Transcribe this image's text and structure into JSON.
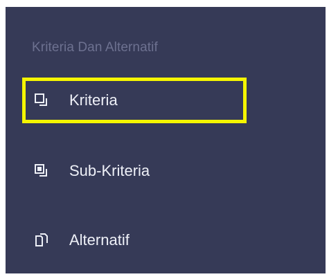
{
  "sidebar": {
    "section_title": "Kriteria Dan Alternatif",
    "items": [
      {
        "label": "Kriteria",
        "icon": "copy-icon"
      },
      {
        "label": "Sub-Kriteria",
        "icon": "copy-filled-icon"
      },
      {
        "label": "Alternatif",
        "icon": "documents-icon"
      }
    ]
  },
  "colors": {
    "sidebar_bg": "#363a57",
    "heading_text": "#6d7190",
    "item_text": "#eef0f7",
    "highlight": "#f5f500"
  }
}
